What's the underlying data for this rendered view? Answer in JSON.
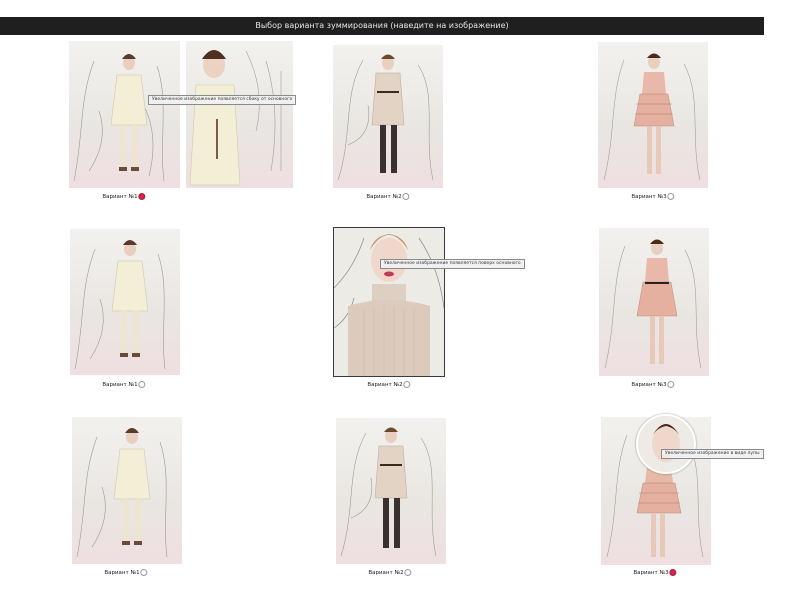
{
  "header": {
    "title": "Выбор варианта зуммирования (наведите на изображение)"
  },
  "cells": [
    {
      "caption": "Вариант №1",
      "selected": true,
      "tooltip": "Увеличенное изображение появляется сбоку от основного"
    },
    {
      "caption": "Вариант №2",
      "selected": false,
      "tooltip": ""
    },
    {
      "caption": "Вариант №3",
      "selected": false,
      "tooltip": ""
    },
    {
      "caption": "Вариант №1",
      "selected": false,
      "tooltip": ""
    },
    {
      "caption": "Вариант №2",
      "selected": false,
      "tooltip": "Увеличенное изображение появляется поверх основного"
    },
    {
      "caption": "Вариант №3",
      "selected": false,
      "tooltip": ""
    },
    {
      "caption": "Вариант №1",
      "selected": false,
      "tooltip": ""
    },
    {
      "caption": "Вариант №2",
      "selected": false,
      "tooltip": ""
    },
    {
      "caption": "Вариант №3",
      "selected": true,
      "tooltip": "Увеличенное изображение в виде лупы"
    }
  ],
  "colors": {
    "header_bg": "#1f1f1f",
    "radio_selected": "#d6244a",
    "dress_cream": "#f3efd6",
    "dress_beige": "#e3d3c4",
    "dress_pink": "#e8b9a8"
  }
}
